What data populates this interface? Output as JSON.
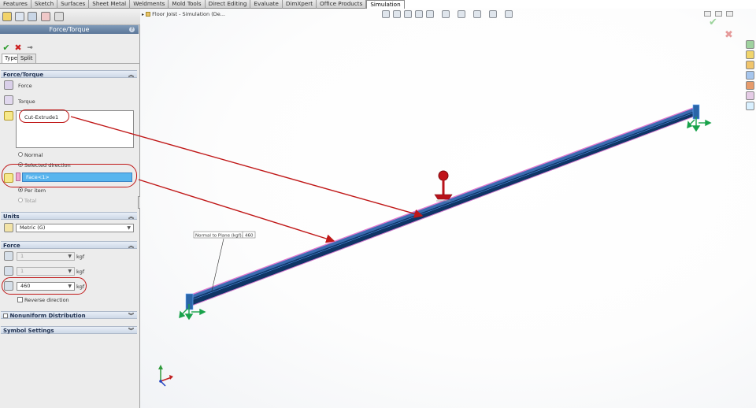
{
  "command_tabs": [
    "Features",
    "Sketch",
    "Surfaces",
    "Sheet Metal",
    "Weldments",
    "Mold Tools",
    "Direct Editing",
    "Evaluate",
    "DimXpert",
    "Office Products",
    "Simulation"
  ],
  "active_tab": "Simulation",
  "property_manager": {
    "title": "Force/Torque",
    "ok_icon": "check-icon",
    "cancel_icon": "x-icon",
    "pin_icon": "pushpin-icon",
    "tabs": [
      "Type",
      "Split"
    ],
    "force_torque": {
      "header": "Force/Torque",
      "force_label": "Force",
      "torque_label": "Torque",
      "faces_list_item": "Cut-Extrude1",
      "normal_label": "Normal",
      "selected_direction_label": "Selected direction",
      "direction_selection": "Face<1>",
      "per_item_label": "Per item",
      "total_label": "Total"
    },
    "units": {
      "header": "Units",
      "value": "Metric (G)"
    },
    "force": {
      "header": "Force",
      "components": [
        {
          "value": "1",
          "unit": "kgf",
          "enabled": false
        },
        {
          "value": "1",
          "unit": "kgf",
          "enabled": false
        },
        {
          "value": "460",
          "unit": "kgf",
          "enabled": true
        }
      ],
      "reverse_direction_label": "Reverse direction"
    },
    "nonuniform": {
      "header": "Nonuniform Distribution"
    },
    "symbol_settings": {
      "header": "Symbol Settings"
    }
  },
  "viewport": {
    "tree_flyout": "Floor Joist - Simulation (De...",
    "callout": {
      "label": "Normal to Plane (kgf):",
      "value": "460"
    }
  },
  "colors": {
    "beam_body": "#0f3566",
    "beam_edge": "#e07ad0",
    "annotation_red": "#c01818",
    "selection_blue": "#58b5ee",
    "pm_title_bar": "#6a86aa"
  }
}
